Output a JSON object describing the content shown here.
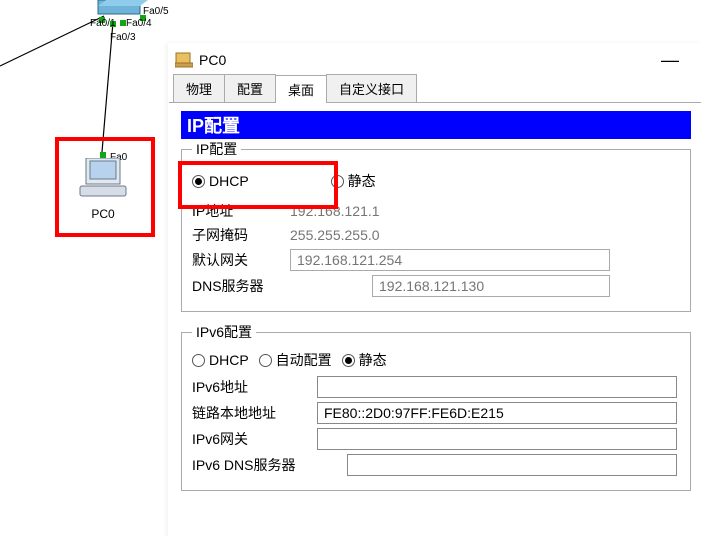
{
  "topology": {
    "ports": {
      "fa01": "Fa0/1",
      "fa03": "Fa0/3",
      "fa04": "Fa0/4",
      "fa05": "Fa0/5",
      "fa0": "Fa0"
    },
    "pc_label": "PC0"
  },
  "window": {
    "title": "PC0",
    "minimize": "—"
  },
  "tabs": {
    "t1": "物理",
    "t2": "配置",
    "t3": "桌面",
    "t4": "自定义接口"
  },
  "panel_title": "IP配置",
  "ipv4": {
    "legend": "IP配置",
    "dhcp": "DHCP",
    "static": "静态",
    "ip_label": "IP地址",
    "ip_value": "192.168.121.1",
    "mask_label": "子网掩码",
    "mask_value": "255.255.255.0",
    "gw_label": "默认网关",
    "gw_value": "192.168.121.254",
    "dns_label": "DNS服务器",
    "dns_value": "192.168.121.130"
  },
  "ipv6": {
    "legend": "IPv6配置",
    "dhcp": "DHCP",
    "auto": "自动配置",
    "static": "静态",
    "addr_label": "IPv6地址",
    "addr_value": "",
    "ll_label": "链路本地地址",
    "ll_value": "FE80::2D0:97FF:FE6D:E215",
    "gw_label": "IPv6网关",
    "gw_value": "",
    "dns_label": "IPv6 DNS服务器",
    "dns_value": ""
  }
}
